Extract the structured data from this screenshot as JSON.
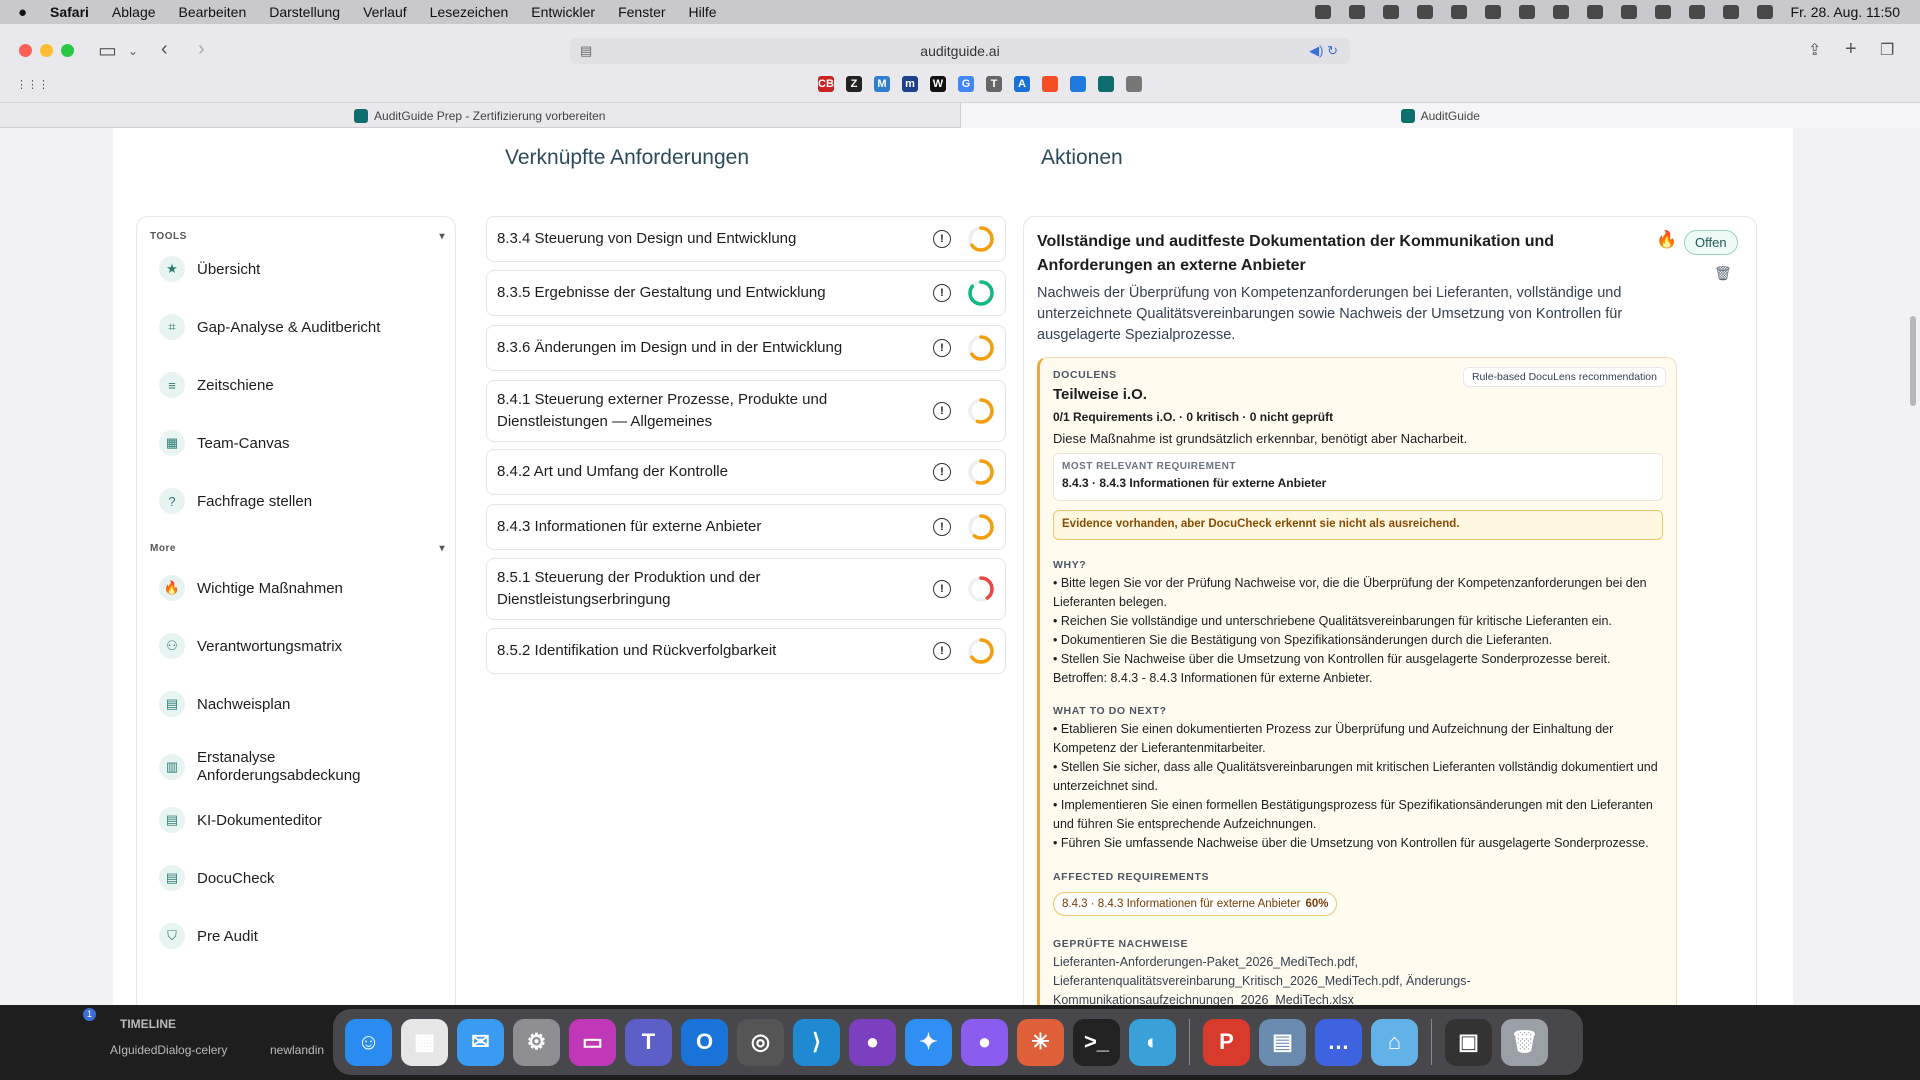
{
  "menubar": {
    "apple": "",
    "items": [
      "Safari",
      "Ablage",
      "Bearbeiten",
      "Darstellung",
      "Verlauf",
      "Lesezeichen",
      "Entwickler",
      "Fenster",
      "Hilfe"
    ],
    "clock": "Fr. 28. Aug.  11:50"
  },
  "browser": {
    "url": "auditguide.ai",
    "tabs": [
      {
        "label": "AuditGuide Prep - Zertifizierung vorbereiten"
      },
      {
        "label": "AuditGuide"
      }
    ],
    "favorites": [
      {
        "icon": "cb-icon",
        "text": "CB",
        "color": "#cc2222"
      },
      {
        "icon": "z-icon",
        "text": "Z",
        "color": "#222222"
      },
      {
        "icon": "m-icon",
        "text": "M",
        "color": "#2f7fd1"
      },
      {
        "icon": "m2-icon",
        "text": "m",
        "color": "#1d3f8c"
      },
      {
        "icon": "w-icon",
        "text": "W",
        "color": "#111111"
      },
      {
        "icon": "google-icon",
        "text": "G",
        "color": "#4285f4"
      },
      {
        "icon": "t-icon",
        "text": "T",
        "color": "#666666"
      },
      {
        "icon": "a-icon",
        "text": "A",
        "color": "#1b6fd6"
      },
      {
        "icon": "ms-icon",
        "text": "",
        "color": "#f25022"
      },
      {
        "icon": "blue-icon",
        "text": "",
        "color": "#1f7ae0"
      },
      {
        "icon": "teal-icon",
        "text": "",
        "color": "#0e6d6d"
      },
      {
        "icon": "globe-icon",
        "text": "",
        "color": "#777777"
      }
    ]
  },
  "sections": {
    "left": "Verknüpfte Anforderungen",
    "right": "Aktionen"
  },
  "sidebar": {
    "tools_label": "TOOLS",
    "more_label": "More",
    "tools": [
      {
        "label": "Übersicht",
        "icon": "star-icon",
        "glyph": "★"
      },
      {
        "label": "Gap-Analyse & Auditbericht",
        "icon": "chart-icon",
        "glyph": "⌗"
      },
      {
        "label": "Zeitschiene",
        "icon": "timeline-icon",
        "glyph": "≡"
      },
      {
        "label": "Team-Canvas",
        "icon": "board-icon",
        "glyph": "▦"
      },
      {
        "label": "Fachfrage stellen",
        "icon": "question-icon",
        "glyph": "?"
      }
    ],
    "more": [
      {
        "label": "Wichtige Maßnahmen",
        "icon": "fire-icon",
        "glyph": "🔥"
      },
      {
        "label": "Verantwortungsmatrix",
        "icon": "people-icon",
        "glyph": "⚇"
      },
      {
        "label": "Nachweisplan",
        "icon": "file-icon",
        "glyph": "▤"
      },
      {
        "label": "Erstanalyse Anforderungsabdeckung",
        "icon": "clipboard-icon",
        "glyph": "▥"
      },
      {
        "label": "KI-Dokumenteditor",
        "icon": "doc-icon",
        "glyph": "▤"
      },
      {
        "label": "DocuCheck",
        "icon": "doc-search-icon",
        "glyph": "▤"
      },
      {
        "label": "Pre Audit",
        "icon": "shield-icon",
        "glyph": "⛉"
      }
    ]
  },
  "requirements": [
    {
      "label": "8.3.4 Steuerung von Design und Entwicklung",
      "progress": 0.65,
      "color": "#f59e0b"
    },
    {
      "label": "8.3.5 Ergebnisse der Gestaltung und Entwicklung",
      "progress": 0.85,
      "color": "#10b981"
    },
    {
      "label": "8.3.6 Änderungen im Design und in der Entwicklung",
      "progress": 0.65,
      "color": "#f59e0b"
    },
    {
      "label": "8.4.1 Steuerung externer Prozesse, Produkte und Dienstleistungen — Allgemeines",
      "progress": 0.55,
      "color": "#f59e0b"
    },
    {
      "label": "8.4.2 Art und Umfang der Kontrolle",
      "progress": 0.55,
      "color": "#f59e0b"
    },
    {
      "label": "8.4.3 Informationen für externe Anbieter",
      "progress": 0.6,
      "color": "#f59e0b"
    },
    {
      "label": "8.5.1 Steuerung der Produktion und der Dienstleistungserbringung",
      "progress": 0.4,
      "color": "#ef4444"
    },
    {
      "label": "8.5.2 Identifikation und Rückverfolgbarkeit",
      "progress": 0.65,
      "color": "#f59e0b"
    }
  ],
  "action": {
    "title": "Vollständige und auditfeste Dokumentation der Kommunikation und Anforderungen an externe Anbieter",
    "status": "Offen",
    "description": "Nachweis der Überprüfung von Kompetenzanforderungen bei Lieferanten, vollständige und unterzeichnete Qualitätsvereinbarungen sowie Nachweis der Umsetzung von Kontrollen für ausgelagerte Spezialprozesse.",
    "doculens": {
      "label": "DOCULENS",
      "rule_badge": "Rule-based DocuLens recommendation",
      "verdict": "Teilweise i.O.",
      "stats": "0/1 Requirements i.O. · 0 kritisch · 0 nicht geprüft",
      "summary": "Diese Maßnahme ist grundsätzlich erkennbar, benötigt aber Nacharbeit.",
      "most_relevant_label": "MOST RELEVANT REQUIREMENT",
      "most_relevant_value": "8.4.3 · 8.4.3 Informationen für externe Anbieter",
      "warning": "Evidence vorhanden, aber DocuCheck erkennt sie nicht als ausreichend.",
      "why_label": "WHY?",
      "why": [
        "• Bitte legen Sie vor der Prüfung Nachweise vor, die die Überprüfung der Kompetenzanforderungen bei den Lieferanten belegen.",
        "• Reichen Sie vollständige und unterschriebene Qualitätsvereinbarungen für kritische Lieferanten ein.",
        "• Dokumentieren Sie die Bestätigung von Spezifikationsänderungen durch die Lieferanten.",
        "• Stellen Sie Nachweise über die Umsetzung von Kontrollen für ausgelagerte Sonderprozesse bereit.",
        "Betroffen: 8.4.3 - 8.4.3 Informationen für externe Anbieter."
      ],
      "next_label": "WHAT TO DO NEXT?",
      "next": [
        "• Etablieren Sie einen dokumentierten Prozess zur Überprüfung und Aufzeichnung der Einhaltung der Kompetenz der Lieferantenmitarbeiter.",
        "• Stellen Sie sicher, dass alle Qualitätsvereinbarungen mit kritischen Lieferanten vollständig dokumentiert und unterzeichnet sind.",
        "• Implementieren Sie einen formellen Bestätigungsprozess für Spezifikationsänderungen mit den Lieferanten und führen Sie entsprechende Aufzeichnungen.",
        "• Führen Sie umfassende Nachweise über die Umsetzung von Kontrollen für ausgelagerte Sonderprozesse."
      ],
      "affected_label": "AFFECTED REQUIREMENTS",
      "affected_item": "8.4.3 · 8.4.3 Informationen für externe Anbieter",
      "affected_pct": "60%",
      "checked_label": "GEPRÜFTE NACHWEISE",
      "checked": "Lieferanten-Anforderungen-Paket_2026_MediTech.pdf, Lieferantenqualitätsvereinbarung_Kritisch_2026_MediTech.pdf, Änderungs-Kommunikationsaufzeichnungen_2026_MediTech.xlsx"
    }
  },
  "terminal": {
    "timeline": "TIMELINE",
    "notif": "1",
    "line1": "AIguidedDialog-celery",
    "line2": "newlandin"
  },
  "dock": [
    {
      "icon": "finder-icon",
      "color": "#2a8cf0",
      "glyph": "☺"
    },
    {
      "icon": "launchpad-icon",
      "color": "#e6e6e6",
      "glyph": "▦"
    },
    {
      "icon": "mail-icon",
      "color": "#3a9bf2",
      "glyph": "✉"
    },
    {
      "icon": "settings-icon",
      "color": "#8e8e93",
      "glyph": "⚙"
    },
    {
      "icon": "screens-icon",
      "color": "#c038b8",
      "glyph": "▭"
    },
    {
      "icon": "teams-icon",
      "color": "#5b5fc7",
      "glyph": "T"
    },
    {
      "icon": "outlook-icon",
      "color": "#1a73d8",
      "glyph": "O"
    },
    {
      "icon": "screenshot-icon",
      "color": "#555555",
      "glyph": "◎"
    },
    {
      "icon": "vscode-icon",
      "color": "#1f8ad2",
      "glyph": "⟩"
    },
    {
      "icon": "github-icon",
      "color": "#7b3fbf",
      "glyph": "●"
    },
    {
      "icon": "safari-icon",
      "color": "#2f8ff5",
      "glyph": "✦"
    },
    {
      "icon": "siri-icon",
      "color": "#8a5cf0",
      "glyph": "●"
    },
    {
      "icon": "claude-icon",
      "color": "#e0603a",
      "glyph": "✳"
    },
    {
      "icon": "terminal-icon",
      "color": "#222222",
      "glyph": ">_"
    },
    {
      "icon": "proxyman-icon",
      "color": "#3aa0d8",
      "glyph": "◐"
    },
    {
      "icon": "powerpoint-icon",
      "color": "#d83b2b",
      "glyph": "P"
    },
    {
      "icon": "preview-icon",
      "color": "#6a8ab0",
      "glyph": "▤"
    },
    {
      "icon": "chat-icon",
      "color": "#3d63e0",
      "glyph": "…"
    },
    {
      "icon": "files-icon",
      "color": "#62b2e8",
      "glyph": "⌂"
    },
    {
      "icon": "gallery-icon",
      "color": "#333333",
      "glyph": "▣"
    },
    {
      "icon": "trash-icon",
      "color": "#9aa0a6",
      "glyph": "🗑"
    }
  ]
}
